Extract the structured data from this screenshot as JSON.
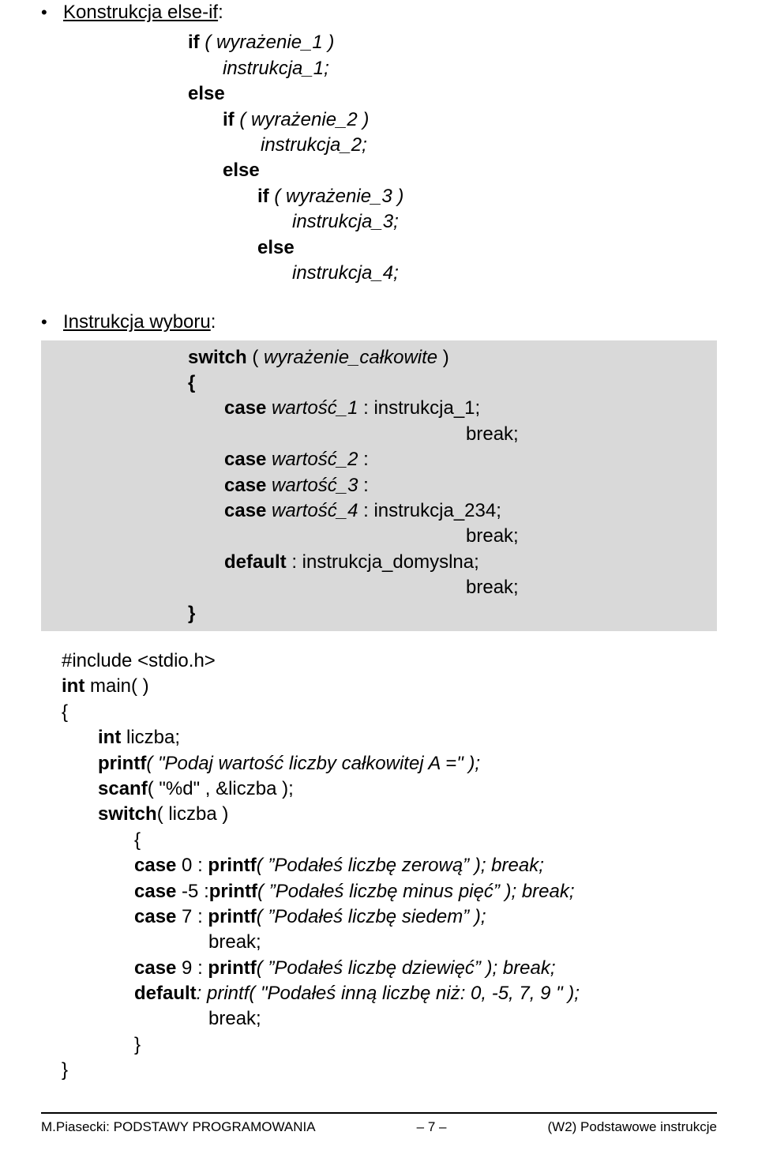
{
  "bullets": {
    "elseif_label": "Konstrukcja  else-if",
    "wyboru_label": "Instrukcja wyboru"
  },
  "elseif": {
    "l1": "if ( wyrażenie_1 )",
    "l2": "instrukcja_1;",
    "l3": "else",
    "l4": "if ( wyrażenie_2 )",
    "l5": "instrukcja_2;",
    "l6": "else",
    "l7": "if ( wyrażenie_3 )",
    "l8": "instrukcja_3;",
    "l9": "else",
    "l10": "instrukcja_4;"
  },
  "switch": {
    "kw_switch": "switch",
    "open_paren": " (",
    "expr": " wyrażenie_całkowite",
    "close_paren": " )",
    "brace_open": "{",
    "c1a": "case",
    "c1b": " wartość_1",
    "c1c": " : instrukcja_1;",
    "brk": "break;",
    "c2a": "case",
    "c2b": " wartość_2",
    "c2c": " :",
    "c3a": "case",
    "c3b": " wartość_3",
    "c3c": " :",
    "c4a": "case",
    "c4b": " wartość_4",
    "c4c": " : instrukcja_234;",
    "def_a": "default",
    "def_b": " : instrukcja_domyslna;",
    "brace_close": "}"
  },
  "code": {
    "include": "#include <stdio.h>",
    "int": "int",
    "main": " main( )",
    "brace_open": "{",
    "intvar": " liczba;",
    "printf": "printf",
    "prompt": "( \"Podaj wartość liczby całkowitej A =\" );",
    "scanf": "scanf",
    "scanf_args": "( \"%d\" , &liczba );",
    "switch": "switch",
    "switch_args": "( liczba )",
    "inner_brace_open": "{",
    "case0a": "case",
    "case0b": " 0 : ",
    "case0c": "( ”Podałeś liczbę zerową” ); break;",
    "case5a": "case",
    "case5b": " -5 :",
    "case5c": "( ”Podałeś liczbę minus pięć” ); break;",
    "case7a": "case",
    "case7b": " 7 : ",
    "case7c": "( ”Podałeś liczbę siedem” );",
    "case7_brk": "break;",
    "case9a": "case",
    "case9b": " 9 : ",
    "case9c": "( ”Podałeś liczbę dziewięć” ); break;",
    "defa": "default",
    "defb": ": printf( \"Podałeś inną liczbę niż: 0, -5, 7, 9 \" );",
    "def_brk": "break;",
    "inner_brace_close": "}",
    "brace_close": "}"
  },
  "footer": {
    "left": "M.Piasecki: PODSTAWY PROGRAMOWANIA",
    "center": "– 7 –",
    "right": "(W2)  Podstawowe instrukcje"
  }
}
